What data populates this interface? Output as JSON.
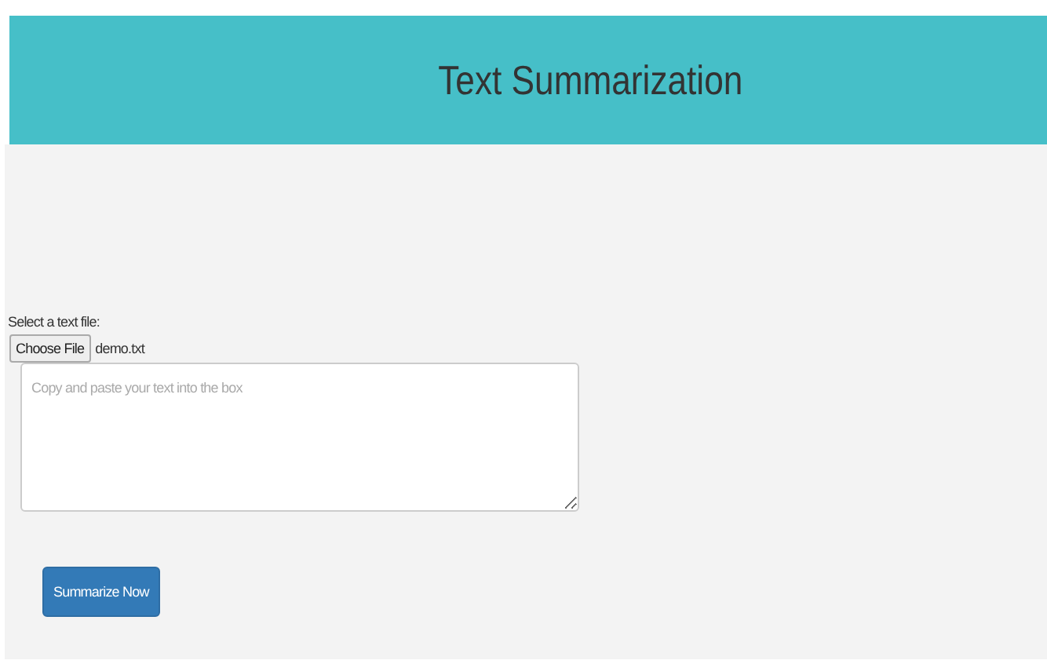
{
  "header": {
    "title": "Text Summarization"
  },
  "file_input": {
    "label": "Select a text file:",
    "button": "Choose File",
    "file_name": "demo.txt"
  },
  "text_area": {
    "placeholder": "Copy and paste your text into the box"
  },
  "submit_button": "Summarize Now"
}
